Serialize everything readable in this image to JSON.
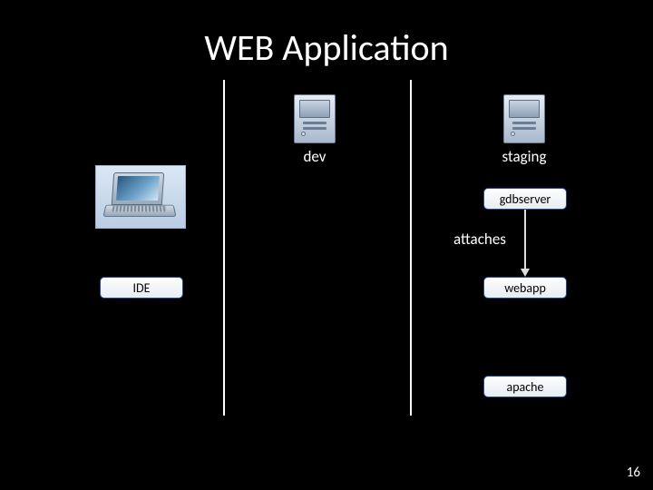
{
  "title": "WEB Application",
  "nodes": {
    "dev": "dev",
    "staging": "staging"
  },
  "boxes": {
    "ide": "IDE",
    "gdbserver": "gdbserver",
    "webapp": "webapp",
    "apache": "apache"
  },
  "labels": {
    "attaches": "attaches"
  },
  "page_number": "16"
}
